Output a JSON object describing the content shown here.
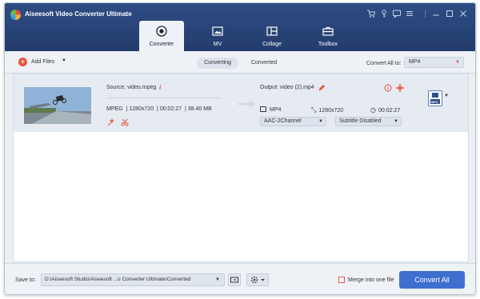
{
  "window": {
    "title": "Aiseesoft Video Converter Ultimate"
  },
  "window_controls": [
    "cart-icon",
    "key-icon",
    "feedback-icon",
    "menu-icon",
    "minimize-icon",
    "maximize-icon",
    "close-icon"
  ],
  "tabs": [
    {
      "label": "Converter",
      "icon": "converter-icon",
      "active": true
    },
    {
      "label": "MV",
      "icon": "mv-icon",
      "active": false
    },
    {
      "label": "Collage",
      "icon": "collage-icon",
      "active": false
    },
    {
      "label": "Toolbox",
      "icon": "toolbox-icon",
      "active": false
    }
  ],
  "toolbar": {
    "add_files": "Add Files",
    "status_tabs": [
      "Converting",
      "Converted"
    ],
    "active_status": "Converting",
    "convert_all_to_label": "Convert All to:",
    "convert_all_to_value": "MP4"
  },
  "file_item": {
    "source_label": "Source: video.mpeg",
    "format": "MPEG",
    "resolution": "1280x720",
    "duration": "00:02:27",
    "size": "38.40 MB",
    "output_label": "Output: video (2).mp4",
    "output_format": "MP4",
    "output_resolution": "1280x720",
    "output_duration": "00:02:27",
    "audio_track": "AAC-2Channel",
    "subtitle": "Subtitle Disabled",
    "format_badge": "MP4"
  },
  "bottom": {
    "save_to_label": "Save to:",
    "save_path": "D:\\Aiseesoft Studio\\Aiseesoft ...o Converter Ultimate\\Converted",
    "merge_label": "Merge into one file",
    "merge_checked": false,
    "convert_all_button": "Convert All"
  },
  "colors": {
    "title_bar": "#2a4578",
    "accent": "#e8543c",
    "primary_button": "#3e6fcf"
  }
}
